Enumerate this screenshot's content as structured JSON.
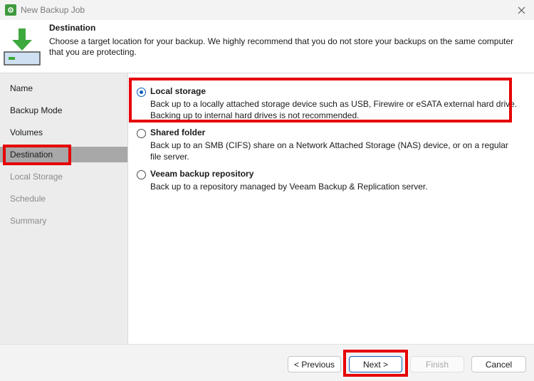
{
  "window": {
    "title": "New Backup Job",
    "app_icon": "veeam-gear-icon",
    "close_icon": "close-icon"
  },
  "header": {
    "title": "Destination",
    "description": "Choose a target location for your backup. We highly recommend that you do not store your backups on the same computer that you are protecting.",
    "icon": "download-drive-icon"
  },
  "sidebar": {
    "items": [
      {
        "label": "Name",
        "state": "enabled"
      },
      {
        "label": "Backup Mode",
        "state": "enabled"
      },
      {
        "label": "Volumes",
        "state": "enabled"
      },
      {
        "label": "Destination",
        "state": "active"
      },
      {
        "label": "Local Storage",
        "state": "disabled"
      },
      {
        "label": "Schedule",
        "state": "disabled"
      },
      {
        "label": "Summary",
        "state": "disabled"
      }
    ]
  },
  "options": [
    {
      "label": "Local storage",
      "description": "Back up to a locally attached storage device such as USB, Firewire or eSATA external hard drive. Backing up to internal hard drives is not recommended.",
      "selected": true
    },
    {
      "label": "Shared folder",
      "description": "Back up to an SMB (CIFS) share on a Network Attached Storage (NAS) device, or on a regular file server.",
      "selected": false
    },
    {
      "label": "Veeam backup repository",
      "description": "Back up to a repository managed by Veeam Backup & Replication server.",
      "selected": false
    }
  ],
  "footer": {
    "previous_label": "< Previous",
    "next_label": "Next >",
    "finish_label": "Finish",
    "cancel_label": "Cancel"
  },
  "colors": {
    "highlight": "#e60000",
    "accent": "#0a5ebd",
    "brand_green": "#3f9a3f"
  }
}
